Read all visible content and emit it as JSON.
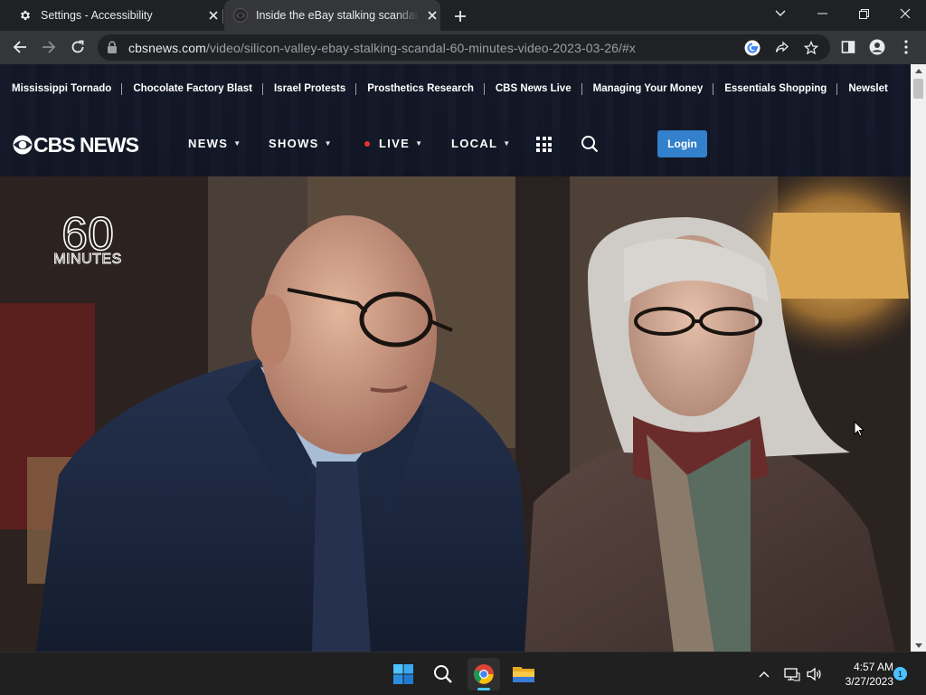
{
  "browser": {
    "tabs": [
      {
        "title": "Settings - Accessibility",
        "icon": "gear-icon"
      },
      {
        "title": "Inside the eBay stalking scandal - ...",
        "icon": "cbs-favicon-icon"
      }
    ],
    "url_host": "cbsnews.com",
    "url_path": "/video/silicon-valley-ebay-stalking-scandal-60-minutes-video-2023-03-26/#x"
  },
  "site": {
    "trending": [
      "Mississippi Tornado",
      "Chocolate Factory Blast",
      "Israel Protests",
      "Prosthetics Research",
      "CBS News Live",
      "Managing Your Money",
      "Essentials Shopping",
      "Newslet"
    ],
    "logo_text": "CBS NEWS",
    "nav": {
      "news": "NEWS",
      "shows": "SHOWS",
      "live": "LIVE",
      "local": "LOCAL"
    },
    "login_label": "Login"
  },
  "video": {
    "show_logo_number": "60",
    "show_logo_word": "MINUTES"
  },
  "taskbar": {
    "time": "4:57 AM",
    "date": "3/27/2023",
    "notification_count": "1"
  },
  "colors": {
    "accent_login": "#3380cc",
    "live_dot": "#e3342f",
    "taskbar_indicator": "#4cc2ff"
  }
}
